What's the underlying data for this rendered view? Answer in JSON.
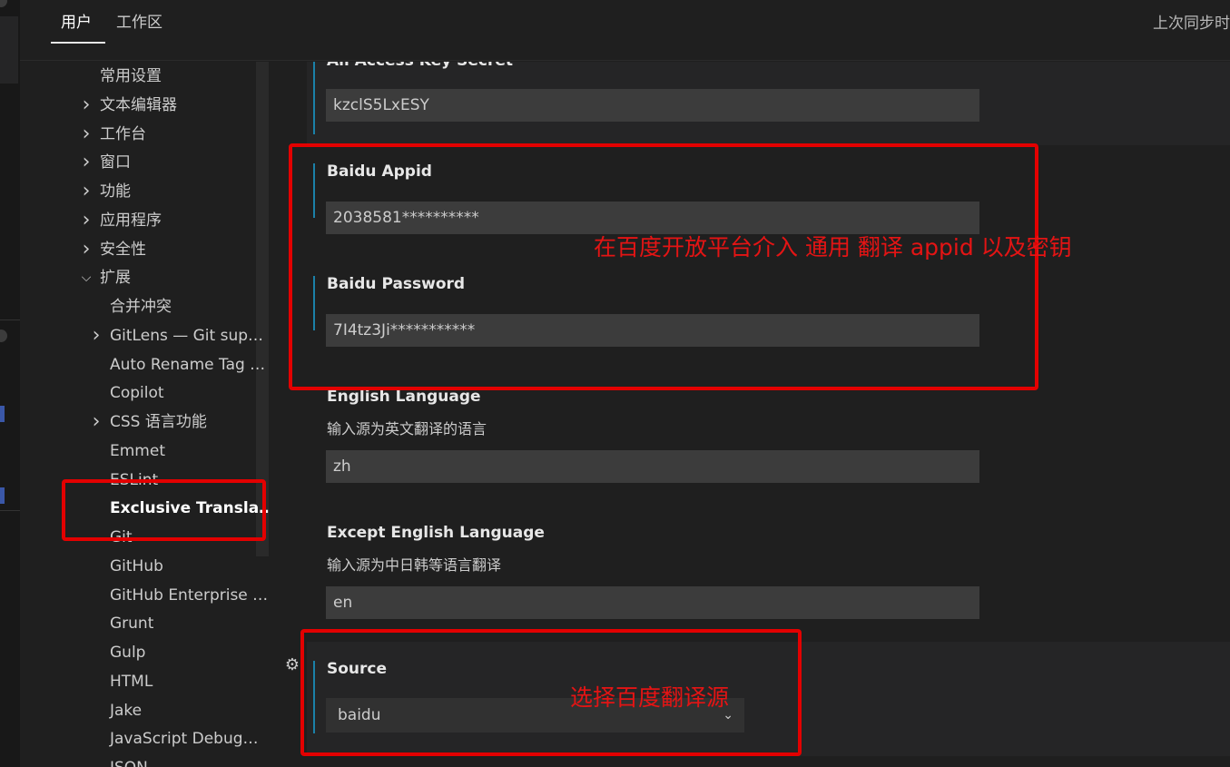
{
  "tabs": {
    "user": "用户",
    "workspace": "工作区",
    "sync_status": "上次同步时"
  },
  "toc": {
    "items": [
      {
        "label": "常用设置",
        "level": 0,
        "chevron": ""
      },
      {
        "label": "文本编辑器",
        "level": 0,
        "chevron": "chevron-right-icon"
      },
      {
        "label": "工作台",
        "level": 0,
        "chevron": "chevron-right-icon"
      },
      {
        "label": "窗口",
        "level": 0,
        "chevron": "chevron-right-icon"
      },
      {
        "label": "功能",
        "level": 0,
        "chevron": "chevron-right-icon"
      },
      {
        "label": "应用程序",
        "level": 0,
        "chevron": "chevron-right-icon"
      },
      {
        "label": "安全性",
        "level": 0,
        "chevron": "chevron-right-icon"
      },
      {
        "label": "扩展",
        "level": 0,
        "chevron": "chevron-down-icon"
      },
      {
        "label": "合并冲突",
        "level": 1,
        "chevron": ""
      },
      {
        "label": "GitLens — Git sup…",
        "level": 1,
        "chevron": "chevron-right-icon"
      },
      {
        "label": "Auto Rename Tag …",
        "level": 1,
        "chevron": ""
      },
      {
        "label": "Copilot",
        "level": 1,
        "chevron": ""
      },
      {
        "label": "CSS 语言功能",
        "level": 1,
        "chevron": "chevron-right-icon"
      },
      {
        "label": "Emmet",
        "level": 1,
        "chevron": ""
      },
      {
        "label": "ESLint",
        "level": 1,
        "chevron": ""
      },
      {
        "label": "Exclusive Transla…",
        "level": 1,
        "chevron": "",
        "selected": true
      },
      {
        "label": "Git",
        "level": 1,
        "chevron": ""
      },
      {
        "label": "GitHub",
        "level": 1,
        "chevron": ""
      },
      {
        "label": "GitHub Enterprise …",
        "level": 1,
        "chevron": ""
      },
      {
        "label": "Grunt",
        "level": 1,
        "chevron": ""
      },
      {
        "label": "Gulp",
        "level": 1,
        "chevron": ""
      },
      {
        "label": "HTML",
        "level": 1,
        "chevron": ""
      },
      {
        "label": "Jake",
        "level": 1,
        "chevron": ""
      },
      {
        "label": "JavaScript Debug…",
        "level": 1,
        "chevron": ""
      },
      {
        "label": "JSON",
        "level": 1,
        "chevron": ""
      }
    ]
  },
  "settings": {
    "ali_secret": {
      "title": "Ali Access Key Secret",
      "value": "kzclS5LxESY"
    },
    "baidu_appid": {
      "title": "Baidu Appid",
      "value": "2038581**********"
    },
    "baidu_password": {
      "title": "Baidu Password",
      "value": "7I4tz3Ji***********"
    },
    "english_language": {
      "title": "English Language",
      "description": "输入源为英文翻译的语言",
      "value": "zh"
    },
    "except_english_language": {
      "title": "Except English Language",
      "description": "输入源为中日韩等语言翻译",
      "value": "en"
    },
    "source": {
      "title": "Source",
      "value": "baidu",
      "caret_icon": "chevron-down-icon"
    },
    "gear_icon": "gear-icon"
  },
  "annotations": {
    "baidu_note": "在百度开放平台介入 通用 翻译 appid 以及密钥",
    "source_note": "选择百度翻译源",
    "color": "#e41414"
  },
  "colors": {
    "background": "#1f1f1f",
    "input_background": "#3c3c3c",
    "focus_bar": "#1b81a8",
    "annotation_red": "#e30000"
  }
}
